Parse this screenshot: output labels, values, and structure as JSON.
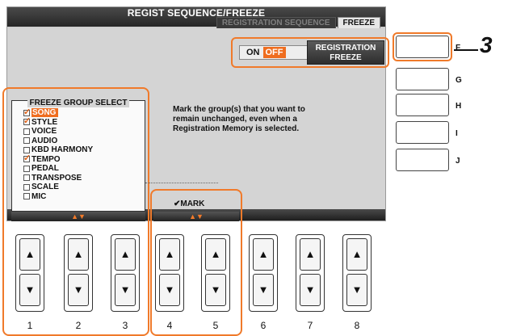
{
  "screen": {
    "title": "REGIST SEQUENCE/FREEZE",
    "tabs": [
      {
        "label": "REGISTRATION SEQUENCE"
      },
      {
        "label": "FREEZE"
      }
    ],
    "on_label": "ON",
    "off_label": "OFF",
    "reg_freeze_line1": "REGISTRATION",
    "reg_freeze_line2": "FREEZE",
    "group_title": "FREEZE GROUP SELECT",
    "groups": [
      {
        "label": "SONG",
        "checked": true,
        "highlighted": true
      },
      {
        "label": "STYLE",
        "checked": true,
        "highlighted": false
      },
      {
        "label": "VOICE",
        "checked": false,
        "highlighted": false
      },
      {
        "label": "AUDIO",
        "checked": false,
        "highlighted": false
      },
      {
        "label": "KBD HARMONY",
        "checked": false,
        "highlighted": false
      },
      {
        "label": "TEMPO",
        "checked": true,
        "highlighted": false
      },
      {
        "label": "PEDAL",
        "checked": false,
        "highlighted": false
      },
      {
        "label": "TRANSPOSE",
        "checked": false,
        "highlighted": false
      },
      {
        "label": "SCALE",
        "checked": false,
        "highlighted": false
      },
      {
        "label": "MIC",
        "checked": false,
        "highlighted": false
      }
    ],
    "description_line1": "Mark the group(s) that you want to",
    "description_line2": "remain unchanged, even when a",
    "description_line3": "Registration Memory is selected.",
    "select_arrows": "▲▼",
    "mark_label": "✔MARK",
    "mark_arrows": "▲▼"
  },
  "side_buttons": [
    {
      "label": "F"
    },
    {
      "label": "G"
    },
    {
      "label": "H"
    },
    {
      "label": "I"
    },
    {
      "label": "J"
    }
  ],
  "callout_number": "3",
  "panel_buttons": [
    {
      "number": "1"
    },
    {
      "number": "2"
    },
    {
      "number": "3"
    },
    {
      "number": "4"
    },
    {
      "number": "5"
    },
    {
      "number": "6"
    },
    {
      "number": "7"
    },
    {
      "number": "8"
    }
  ],
  "up_glyph": "▲",
  "down_glyph": "▼",
  "colors": {
    "accent": "#ef6d1f",
    "lcd": "#d4d4d4",
    "bar": "#2d2d2d"
  }
}
